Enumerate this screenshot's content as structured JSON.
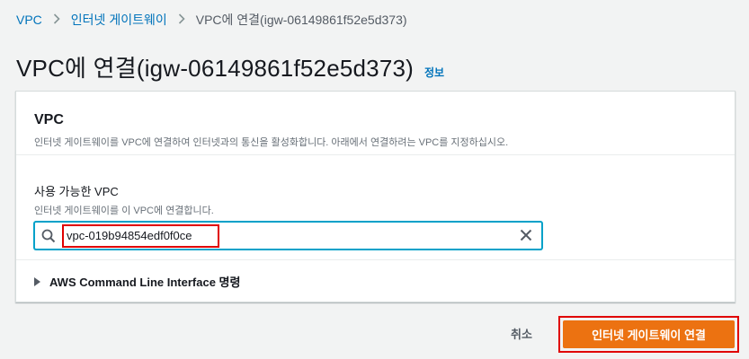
{
  "breadcrumb": {
    "items": [
      "VPC",
      "인터넷 게이트웨이"
    ],
    "current": "VPC에 연결(igw-06149861f52e5d373)"
  },
  "page": {
    "title": "VPC에 연결(igw-06149861f52e5d373)",
    "info_link": "정보"
  },
  "panel": {
    "title": "VPC",
    "description": "인터넷 게이트웨이를 VPC에 연결하여 인터넷과의 통신을 활성화합니다. 아래에서 연결하려는 VPC를 지정하십시오.",
    "field": {
      "label": "사용 가능한 VPC",
      "description": "인터넷 게이트웨이를 이 VPC에 연결합니다.",
      "value": "vpc-019b94854edf0f0ce"
    },
    "expander_label": "AWS Command Line Interface 명령"
  },
  "actions": {
    "cancel_label": "취소",
    "primary_label": "인터넷 게이트웨이 연결"
  },
  "colors": {
    "link": "#0073bb",
    "primary": "#ec7211",
    "focus": "#00a1c9",
    "highlight": "#e00000"
  },
  "icons": [
    "chevron-right-icon",
    "search-icon",
    "close-icon",
    "caret-right-icon"
  ]
}
